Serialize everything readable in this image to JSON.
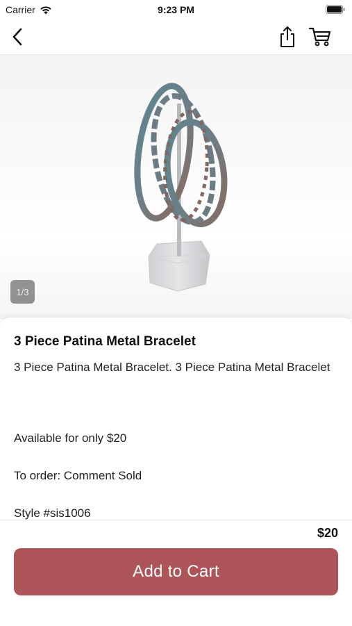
{
  "status_bar": {
    "carrier": "Carrier",
    "time": "9:23 PM"
  },
  "nav": {
    "back_icon": "chevron-left-icon",
    "share_icon": "share-icon",
    "cart_icon": "cart-icon"
  },
  "product": {
    "image_counter": "1/3",
    "title": "3 Piece Patina Metal Bracelet",
    "description": "3 Piece Patina Metal Bracelet. 3 Piece Patina Metal Bracelet",
    "availability": "Available for only $20",
    "order_info": "To order: Comment Sold",
    "style": "Style #sis1006",
    "price": "$20"
  },
  "actions": {
    "add_to_cart_label": "Add to Cart"
  },
  "colors": {
    "accent": "#ad5458"
  }
}
